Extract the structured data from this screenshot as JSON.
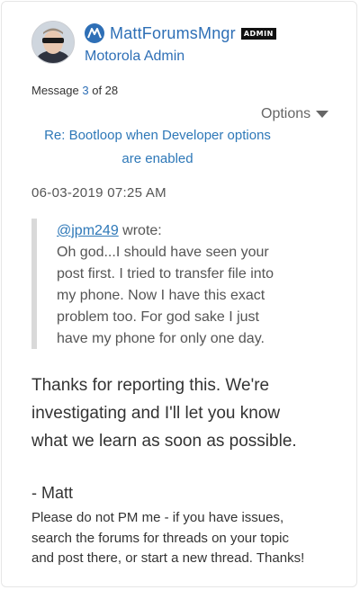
{
  "author": {
    "name": "MattForumsMngr",
    "badge": "ADMIN",
    "role": "Motorola Admin",
    "avatar_icon": "user-avatar-icon",
    "brand_icon": "motorola-logo-icon",
    "brand_color": "#2e6fb6"
  },
  "message_meta": {
    "prefix": "Message ",
    "number": "3",
    "suffix": " of 28"
  },
  "options": {
    "label": "Options",
    "icon": "caret-down-icon"
  },
  "subject": {
    "line1": "Re: Bootloop when Developer options",
    "line2": "are enabled"
  },
  "post_date": "06-03-2019 07:25 AM",
  "quote": {
    "user": "@jpm249",
    "wrote": " wrote:",
    "lines": [
      "Oh god...I should have seen your",
      "post first. I tried to transfer file into",
      "my phone. Now I have this exact",
      "problem too. For god sake I just",
      "have my phone for only one day."
    ]
  },
  "reply": {
    "lines": [
      "Thanks for reporting this. We're",
      "investigating and I'll let you know",
      "what we learn as soon as possible."
    ]
  },
  "signature": {
    "name": "- Matt",
    "note_lines": [
      "Please do not PM me - if you have issues,",
      "search the forums for threads on your topic",
      "and post there, or start a new thread. Thanks!"
    ]
  }
}
